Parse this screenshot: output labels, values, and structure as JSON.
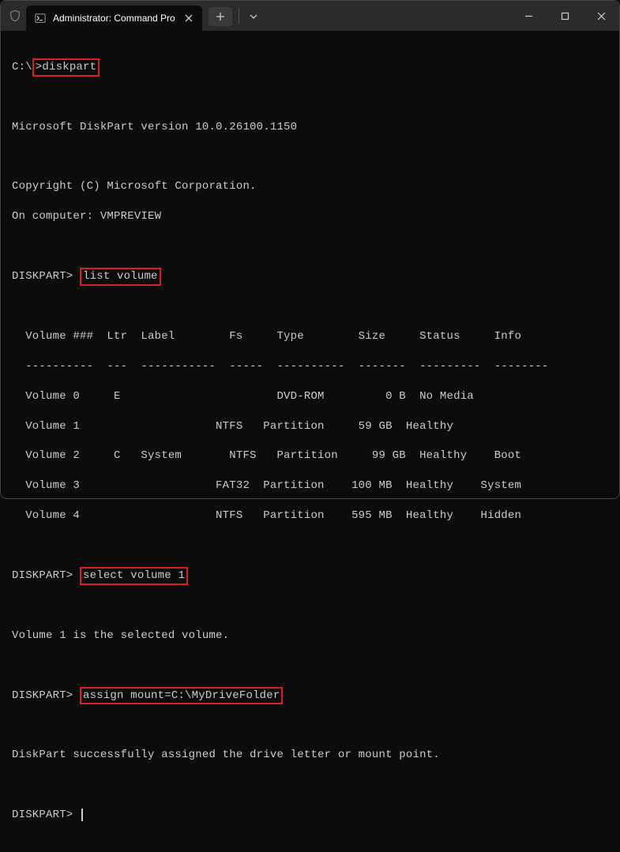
{
  "titlebar": {
    "tab_title": "Administrator: Command Pro"
  },
  "terminal": {
    "prompt1_pre": "C:\\",
    "prompt1_post": ">",
    "cmd1": "diskpart",
    "version_line": "Microsoft DiskPart version 10.0.26100.1150",
    "copyright_line": "Copyright (C) Microsoft Corporation.",
    "computer_line": "On computer: VMPREVIEW",
    "dp_prompt": "DISKPART>",
    "cmd2": "list volume",
    "table_header": "  Volume ###  Ltr  Label        Fs     Type        Size     Status     Info",
    "table_sep": "  ----------  ---  -----------  -----  ----------  -------  ---------  --------",
    "rows": [
      "  Volume 0     E                       DVD-ROM         0 B  No Media",
      "  Volume 1                    NTFS   Partition     59 GB  Healthy",
      "  Volume 2     C   System       NTFS   Partition     99 GB  Healthy    Boot",
      "  Volume 3                    FAT32  Partition    100 MB  Healthy    System",
      "  Volume 4                    NTFS   Partition    595 MB  Healthy    Hidden"
    ],
    "cmd3": "select volume 1",
    "resp3": "Volume 1 is the selected volume.",
    "cmd4": "assign mount=C:\\MyDriveFolder",
    "resp4": "DiskPart successfully assigned the drive letter or mount point."
  }
}
